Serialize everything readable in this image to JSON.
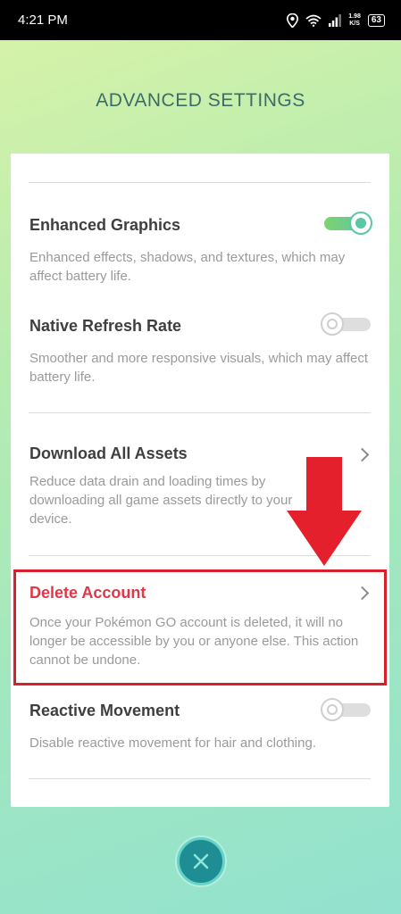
{
  "statusbar": {
    "time": "4:21 PM",
    "speed_value": "1.98",
    "speed_unit": "K/S",
    "battery": "63",
    "icons": [
      "location-icon",
      "wifi-icon",
      "signal-icon"
    ]
  },
  "page": {
    "title": "ADVANCED SETTINGS"
  },
  "settings": [
    {
      "title": "Enhanced Graphics",
      "description": "Enhanced effects, shadows, and textures, which may affect battery life.",
      "control": "toggle",
      "enabled": true
    },
    {
      "title": "Native Refresh Rate",
      "description": "Smoother and more responsive visuals, which may affect battery life.",
      "control": "toggle",
      "enabled": false
    },
    {
      "title": "Download All Assets",
      "description": "Reduce data drain and loading times by downloading all game assets directly to your device.",
      "control": "chevron"
    },
    {
      "title": "Delete Account",
      "description": "Once your Pokémon GO account is deleted, it will no longer be accessible by you or anyone else. This action cannot be undone.",
      "control": "chevron",
      "highlighted": true
    },
    {
      "title": "Reactive Movement",
      "description": "Disable reactive movement for hair and clothing.",
      "control": "toggle",
      "enabled": false
    }
  ],
  "colors": {
    "accent": "#5ac7a3",
    "danger": "#e0384a",
    "annotation": "#d7202b",
    "close_button": "#1f8e94"
  },
  "close_icon": "close-icon"
}
